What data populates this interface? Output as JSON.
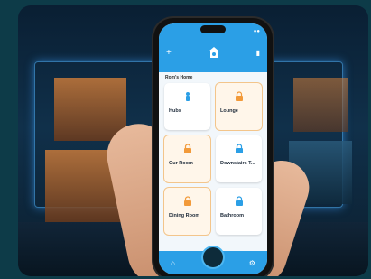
{
  "app": {
    "section_title": "Rom's Home",
    "rooms": [
      {
        "name": "Hubs",
        "subtitle": "",
        "icon": "hub-icon",
        "accent": false
      },
      {
        "name": "Lounge",
        "subtitle": "",
        "icon": "lock-icon",
        "accent": true
      },
      {
        "name": "Our Room",
        "subtitle": "",
        "icon": "lock-icon",
        "accent": true
      },
      {
        "name": "Downstairs T...",
        "subtitle": "",
        "icon": "lock-icon",
        "accent": false
      },
      {
        "name": "Dining Room",
        "subtitle": "",
        "icon": "lock-icon",
        "accent": true
      },
      {
        "name": "Bathroom",
        "subtitle": "",
        "icon": "lock-icon",
        "accent": false
      }
    ]
  },
  "colors": {
    "primary": "#2b9fe6",
    "accent": "#f29a3a",
    "background": "#0d3b48"
  }
}
